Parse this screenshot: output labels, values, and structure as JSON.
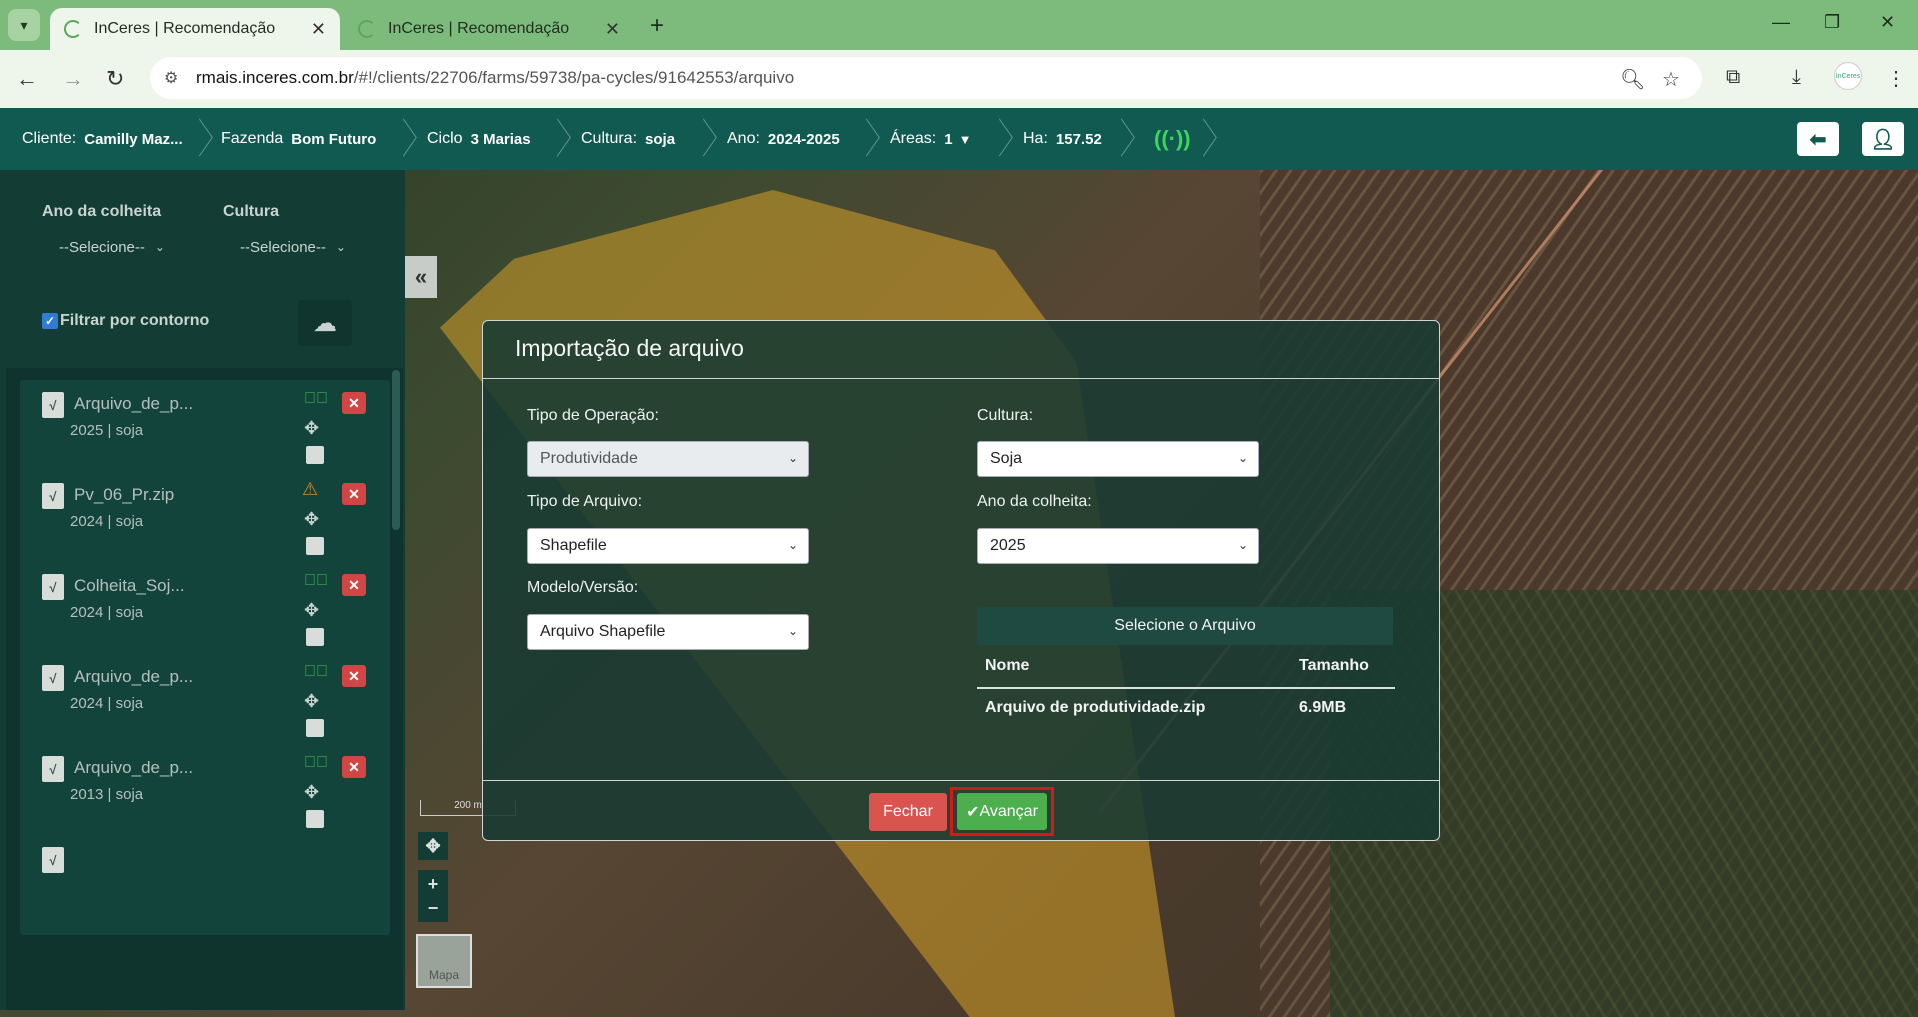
{
  "browser": {
    "tabs": [
      {
        "title": "InCeres | Recomendação",
        "active": true
      },
      {
        "title": "InCeres | Recomendação",
        "active": false
      }
    ],
    "url_host": "rmais.inceres.com.br",
    "url_path": "/#!/clients/22706/farms/59738/pa-cycles/91642553/arquivo",
    "profile_label": "InCeres"
  },
  "header": {
    "cliente_label": "Cliente:",
    "cliente_value": "Camilly Maz...",
    "fazenda_label": "Fazenda",
    "fazenda_value": "Bom Futuro",
    "ciclo_label": "Ciclo",
    "ciclo_value": "3 Marias",
    "cultura_label": "Cultura:",
    "cultura_value": "soja",
    "ano_label": "Ano:",
    "ano_value": "2024-2025",
    "areas_label": "Áreas:",
    "areas_value": "1",
    "ha_label": "Ha:",
    "ha_value": "157.52"
  },
  "sidebar": {
    "ano_label": "Ano da colheita",
    "ano_value": "--Selecione--",
    "cultura_label": "Cultura",
    "cultura_value": "--Selecione--",
    "filter_label": "Filtrar por contorno",
    "files": [
      {
        "name": "Arquivo_de_p...",
        "meta": "2025 | soja",
        "status": "ok"
      },
      {
        "name": "Pv_06_Pr.zip",
        "meta": "2024 | soja",
        "status": "warning"
      },
      {
        "name": "Colheita_Soj...",
        "meta": "2024 | soja",
        "status": "ok"
      },
      {
        "name": "Arquivo_de_p...",
        "meta": "2024 | soja",
        "status": "ok"
      },
      {
        "name": "Arquivo_de_p...",
        "meta": "2013 | soja",
        "status": "ok"
      }
    ]
  },
  "map": {
    "scale_label": "200 m",
    "basemap_label": "Mapa"
  },
  "modal": {
    "title": "Importação de arquivo",
    "tipo_operacao_label": "Tipo de Operação:",
    "tipo_operacao_value": "Produtividade",
    "cultura_label": "Cultura:",
    "cultura_value": "Soja",
    "tipo_arquivo_label": "Tipo de Arquivo:",
    "tipo_arquivo_value": "Shapefile",
    "ano_colheita_label": "Ano da colheita:",
    "ano_colheita_value": "2025",
    "modelo_label": "Modelo/Versão:",
    "modelo_value": "Arquivo Shapefile",
    "select_file_label": "Selecione o Arquivo",
    "table": {
      "headers": [
        "Nome",
        "Tamanho"
      ],
      "rows": [
        [
          "Arquivo de produtividade.zip",
          "6.9MB"
        ]
      ]
    },
    "close_label": "Fechar",
    "next_label": "Avançar"
  }
}
